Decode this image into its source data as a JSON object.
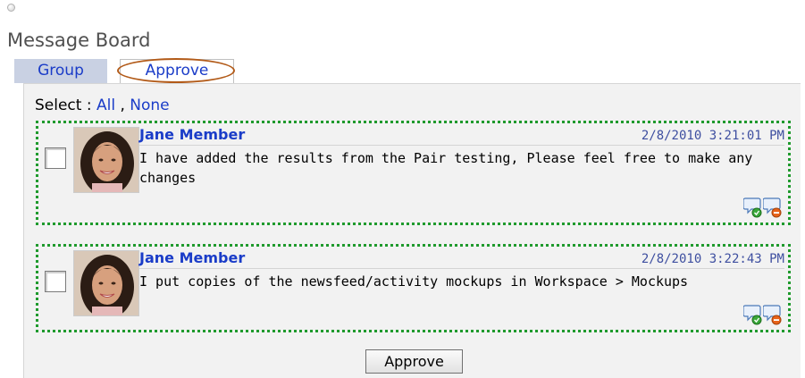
{
  "board": {
    "title": "Message Board"
  },
  "tabs": [
    {
      "label": "Group"
    },
    {
      "label": "Approve"
    }
  ],
  "select": {
    "label": "Select : ",
    "all": "All",
    "separator": " , ",
    "none": "None"
  },
  "messages": [
    {
      "author": "Jane Member",
      "timestamp": "2/8/2010 3:21:01 PM",
      "body": "I have added the results from the Pair testing, Please feel free to make any changes"
    },
    {
      "author": "Jane Member",
      "timestamp": "2/8/2010 3:22:43 PM",
      "body": "I put copies of the newsfeed/activity mockups in Workspace > Mockups"
    }
  ],
  "actions": {
    "approve_label": "Approve"
  },
  "colors": {
    "link": "#1a3cc8",
    "border_dotted": "#1f9a2d",
    "highlight_circle": "#b25a18"
  },
  "icons": [
    "comment-approve-icon",
    "comment-reject-icon"
  ]
}
